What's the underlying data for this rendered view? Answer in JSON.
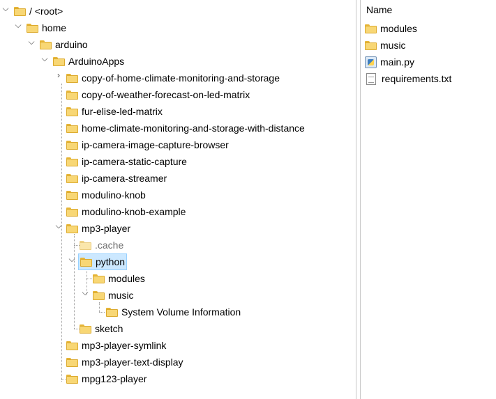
{
  "tree": {
    "root": "/ <root>",
    "home": "home",
    "arduino": "arduino",
    "arduino_apps": "ArduinoApps",
    "apps": [
      "copy-of-home-climate-monitoring-and-storage",
      "copy-of-weather-forecast-on-led-matrix",
      "fur-elise-led-matrix",
      "home-climate-monitoring-and-storage-with-distance",
      "ip-camera-image-capture-browser",
      "ip-camera-static-capture",
      "ip-camera-streamer",
      "modulino-knob",
      "modulino-knob-example",
      "mp3-player"
    ],
    "mp3_children": {
      "cache": ".cache",
      "python": "python",
      "modules": "modules",
      "music": "music",
      "sysvol": "System Volume Information",
      "sketch": "sketch"
    },
    "after_apps": [
      "mp3-player-symlink",
      "mp3-player-text-display",
      "mpg123-player"
    ]
  },
  "files": {
    "header": "Name",
    "items": [
      {
        "name": "modules",
        "icon": "folder-icon"
      },
      {
        "name": "music",
        "icon": "folder-icon"
      },
      {
        "name": "main.py",
        "icon": "python-file-icon"
      },
      {
        "name": "requirements.txt",
        "icon": "text-file-icon"
      }
    ]
  }
}
